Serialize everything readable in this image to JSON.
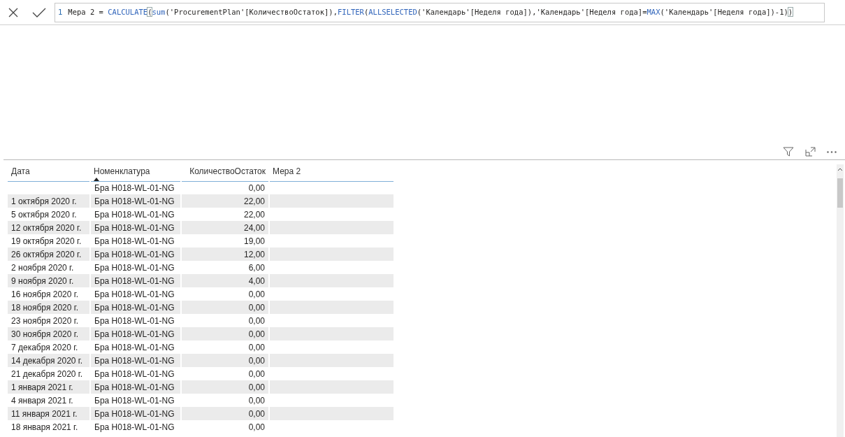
{
  "formula_bar": {
    "line_number": "1",
    "tokens": [
      {
        "kind": "text",
        "text": "Мера 2 = "
      },
      {
        "kind": "function",
        "text": "CALCULATE"
      },
      {
        "kind": "bracket",
        "text": "("
      },
      {
        "kind": "function",
        "text": "sum"
      },
      {
        "kind": "text",
        "text": "('ProcurementPlan'[КоличествоОстаток]),"
      },
      {
        "kind": "function",
        "text": "FILTER"
      },
      {
        "kind": "text",
        "text": "("
      },
      {
        "kind": "function",
        "text": "ALLSELECTED"
      },
      {
        "kind": "text",
        "text": "('Календарь'[Неделя года]),'Календарь'[Неделя года]="
      },
      {
        "kind": "function",
        "text": "MAX"
      },
      {
        "kind": "text",
        "text": "('Календарь'[Неделя года])-1)"
      },
      {
        "kind": "bracket",
        "text": ")"
      }
    ]
  },
  "table": {
    "columns": [
      {
        "label": "Дата",
        "numeric": false,
        "sorted": false
      },
      {
        "label": "Номенклатура",
        "numeric": false,
        "sorted": true
      },
      {
        "label": "КоличествоОстаток",
        "numeric": true,
        "sorted": false
      },
      {
        "label": "Мера 2",
        "numeric": false,
        "sorted": false
      }
    ],
    "rows": [
      [
        "",
        "Бра H018-WL-01-NG",
        "0,00"
      ],
      [
        "1 октября 2020 г.",
        "Бра H018-WL-01-NG",
        "22,00"
      ],
      [
        "5 октября 2020 г.",
        "Бра H018-WL-01-NG",
        "22,00"
      ],
      [
        "12 октября 2020 г.",
        "Бра H018-WL-01-NG",
        "24,00"
      ],
      [
        "19 октября 2020 г.",
        "Бра H018-WL-01-NG",
        "19,00"
      ],
      [
        "26 октября 2020 г.",
        "Бра H018-WL-01-NG",
        "12,00"
      ],
      [
        "2 ноября 2020 г.",
        "Бра H018-WL-01-NG",
        "6,00"
      ],
      [
        "9 ноября 2020 г.",
        "Бра H018-WL-01-NG",
        "4,00"
      ],
      [
        "16 ноября 2020 г.",
        "Бра H018-WL-01-NG",
        "0,00"
      ],
      [
        "18 ноября 2020 г.",
        "Бра H018-WL-01-NG",
        "0,00"
      ],
      [
        "23 ноября 2020 г.",
        "Бра H018-WL-01-NG",
        "0,00"
      ],
      [
        "30 ноября 2020 г.",
        "Бра H018-WL-01-NG",
        "0,00"
      ],
      [
        "7 декабря 2020 г.",
        "Бра H018-WL-01-NG",
        "0,00"
      ],
      [
        "14 декабря 2020 г.",
        "Бра H018-WL-01-NG",
        "0,00"
      ],
      [
        "21 декабря 2020 г.",
        "Бра H018-WL-01-NG",
        "0,00"
      ],
      [
        "1 января 2021 г.",
        "Бра H018-WL-01-NG",
        "0,00"
      ],
      [
        "4 января 2021 г.",
        "Бра H018-WL-01-NG",
        "0,00"
      ],
      [
        "11 января 2021 г.",
        "Бра H018-WL-01-NG",
        "0,00"
      ],
      [
        "18 января 2021 г.",
        "Бра H018-WL-01-NG",
        "0,00"
      ]
    ]
  }
}
